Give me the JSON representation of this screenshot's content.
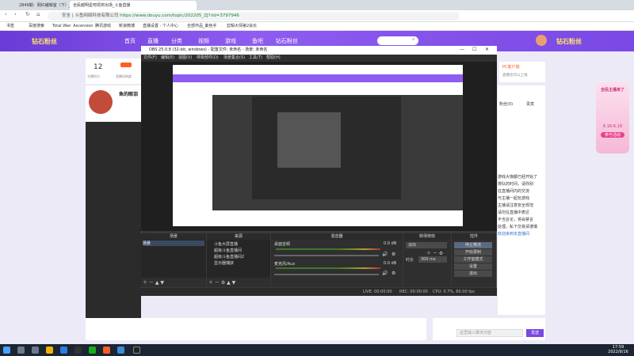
{
  "browser": {
    "tabs": [
      {
        "label": "2849期：网红编辑室（下）_网络游戏"
      },
      {
        "label": "全民越明星吧领奖出场_斗鱼直播"
      }
    ],
    "url": "https://www.douyu.com/topic/202205_ZJ?rid=3797946",
    "url_prefix": "安全 | 斗鱼网络科技有限公司",
    "bookmarks": [
      {
        "label": "书签"
      },
      {
        "label": "百度搜索"
      },
      {
        "label": "Total War: Ascension"
      },
      {
        "label": "腾讯游戏"
      },
      {
        "label": "新浪微博"
      },
      {
        "label": "直播设置 - 个人中心"
      },
      {
        "label": "全部作品_紫色手"
      },
      {
        "label": "剪辑大师第2会长"
      }
    ]
  },
  "site": {
    "nav": [
      {
        "label": "首页"
      },
      {
        "label": "直播"
      },
      {
        "label": "分类"
      },
      {
        "label": "视频"
      },
      {
        "label": "游戏"
      },
      {
        "label": "鱼吧"
      },
      {
        "label": "钻石粉丝"
      }
    ],
    "brand_left": "钻石粉丝",
    "brand_right": "钻石粉丝",
    "room_stats": {
      "value": "12",
      "label1": "主播积分",
      "label2": "直播间热度"
    },
    "stream_title": "鱼的眼泪",
    "right_panel": {
      "tab1": "PC客户端",
      "text1": "直播也可以上线",
      "tab_fans": "粉丝(0)",
      "tab_honor": "贵宾",
      "lines": [
        "游戏大咖都已经开始了",
        "排队的时间，请你别",
        "在直播间内的交流",
        "与主播一起玩游戏",
        "主播请注意安全规范",
        "请勿在直播中表达",
        "不当言论，将会禁言",
        "处理，私下交易请谨慎"
      ],
      "welcome": "欢迎来到本直播间"
    },
    "promo": {
      "title": "全民主播来了",
      "date": "6.16-6.18",
      "cta": "参与活动"
    },
    "chat_placeholder": "这里输入聊天内容",
    "send_label": "发送"
  },
  "obs": {
    "title": "OBS 25.0.8 (32-bit, windows) - 配置文件: 未命名 - 场景: 未命名",
    "menu": [
      "文件(F)",
      "编辑(E)",
      "视图(V)",
      "停靠部件(D)",
      "场景集合(S)",
      "工具(T)",
      "帮助(H)"
    ],
    "docks": {
      "scenes": "场景",
      "sources": "来源",
      "mixer": "混音器",
      "transitions": "转场特效",
      "controls": "控件"
    },
    "scene_items": [
      "场景"
    ],
    "source_items": [
      "斗鱼大屏直播",
      "超级斗鱼直播间",
      "超级斗鱼直播间2",
      "显示器捕获"
    ],
    "mixer_channels": [
      {
        "name": "桌面音频",
        "db": "0.0 dB"
      },
      {
        "name": "麦克风/Aux",
        "db": "0.0 dB"
      }
    ],
    "transition": {
      "name": "淡出",
      "duration_label": "时长",
      "duration_value": "300 ms"
    },
    "control_buttons": [
      "停止推流",
      "开始录制",
      "工作室模式",
      "设置",
      "退出"
    ],
    "status": {
      "live": "LIVE: 00:00:00",
      "rec": "REC: 00:00:00",
      "cpu": "CPU: 0.7%, 60.00 fps"
    }
  },
  "taskbar": {
    "time": "17:59",
    "date": "2022/6/16"
  }
}
